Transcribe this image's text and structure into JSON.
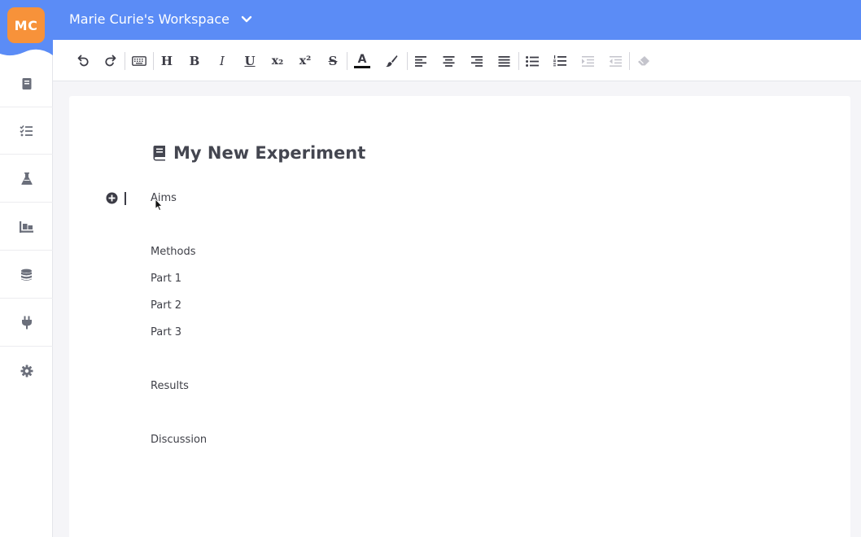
{
  "header": {
    "avatar_initials": "MC",
    "workspace_name": "Marie Curie's Workspace"
  },
  "sidebar": {
    "items": [
      {
        "name": "notebook",
        "icon": "book-icon"
      },
      {
        "name": "tasks",
        "icon": "checklist-icon"
      },
      {
        "name": "experiments",
        "icon": "flask-icon"
      },
      {
        "name": "inventory",
        "icon": "warehouse-icon"
      },
      {
        "name": "database",
        "icon": "database-icon"
      },
      {
        "name": "integrations",
        "icon": "plug-icon"
      },
      {
        "name": "settings",
        "icon": "gear-icon"
      }
    ]
  },
  "toolbar": {
    "heading_label": "H",
    "bold_label": "B",
    "italic_label": "I",
    "underline_label": "U",
    "subscript_label": "x₂",
    "superscript_label": "x²",
    "strikethrough_label": "S",
    "font_color_label": "A"
  },
  "document": {
    "title": "My New Experiment",
    "lines": [
      "Aims",
      "Methods",
      "Part 1",
      "Part 2",
      "Part 3",
      "Results",
      "Discussion"
    ]
  },
  "colors": {
    "header_bg": "#5b8cf6",
    "avatar_bg": "#f7923a",
    "text_dark": "#3c3c46"
  }
}
